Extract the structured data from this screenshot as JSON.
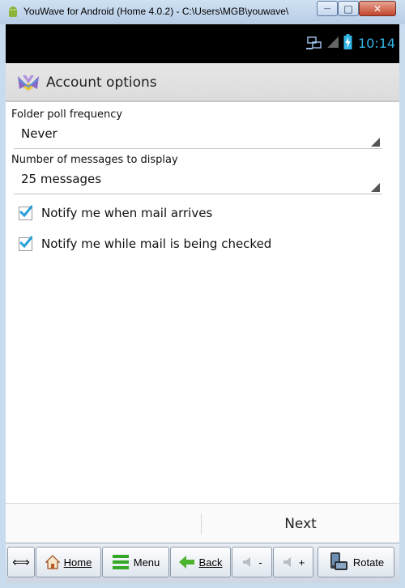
{
  "window": {
    "title": "YouWave for Android (Home 4.0.2) - C:\\Users\\MGB\\youwave\\",
    "minimize_glyph": "—",
    "maximize_glyph": "□",
    "close_glyph": "✕"
  },
  "statusbar": {
    "time": "10:14",
    "icons": [
      "network-icon",
      "signal-icon",
      "battery-charging-icon"
    ]
  },
  "actionbar": {
    "title": "Account options",
    "logo": "app-logo-icon"
  },
  "settings": {
    "poll_label": "Folder poll frequency",
    "poll_value": "Never",
    "messages_label": "Number of messages to display",
    "messages_value": "25 messages",
    "notify_arrives": {
      "label": "Notify me when mail arrives",
      "checked": true
    },
    "notify_checked": {
      "label": "Notify me while mail is being checked",
      "checked": true
    }
  },
  "bottom": {
    "next_label": "Next"
  },
  "toolbar": {
    "resize_glyph": "⟺",
    "home_label": "Home",
    "menu_label": "Menu",
    "back_label": "Back",
    "vol_down_label": "-",
    "vol_up_label": "+",
    "rotate_label": "Rotate"
  },
  "colors": {
    "accent": "#33b5e5",
    "check": "#2a9fd8"
  }
}
